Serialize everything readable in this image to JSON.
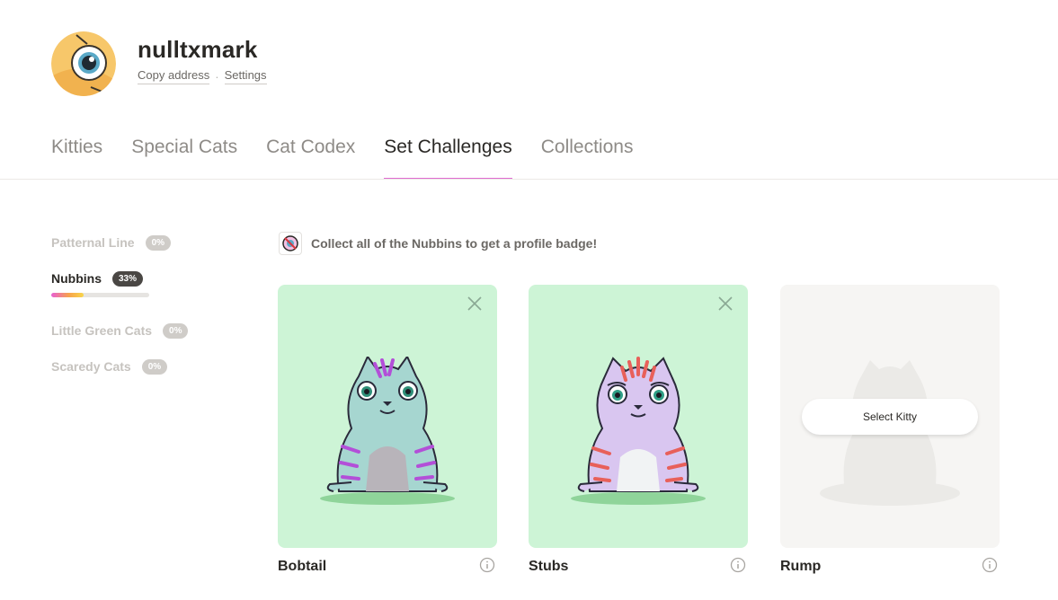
{
  "profile": {
    "username": "nulltxmark",
    "copy_address": "Copy address",
    "separator": "·",
    "settings": "Settings"
  },
  "tabs": [
    {
      "label": "Kitties",
      "active": false
    },
    {
      "label": "Special Cats",
      "active": false
    },
    {
      "label": "Cat Codex",
      "active": false
    },
    {
      "label": "Set Challenges",
      "active": true
    },
    {
      "label": "Collections",
      "active": false
    }
  ],
  "sets": [
    {
      "name": "Patternal Line",
      "percent": "0%",
      "active": false
    },
    {
      "name": "Nubbins",
      "percent": "33%",
      "active": true,
      "progress": 0.33
    },
    {
      "name": "Little Green Cats",
      "percent": "0%",
      "active": false
    },
    {
      "name": "Scaredy Cats",
      "percent": "0%",
      "active": false
    }
  ],
  "challenge": {
    "message": "Collect all of the Nubbins to get a profile badge!"
  },
  "cards": [
    {
      "name": "Bobtail",
      "state": "owned",
      "body_color": "#a6d6d0",
      "stripe_color": "#b34fd8",
      "belly_color": "#b8b4ba"
    },
    {
      "name": "Stubs",
      "state": "owned",
      "body_color": "#d9c6f0",
      "stripe_color": "#e8605a",
      "belly_color": "#f1f3f4"
    },
    {
      "name": "Rump",
      "state": "empty",
      "select_label": "Select Kitty"
    }
  ],
  "colors": {
    "accent": "#e06bd0",
    "card_green": "#cdf4d6",
    "card_empty": "#f6f5f3"
  }
}
